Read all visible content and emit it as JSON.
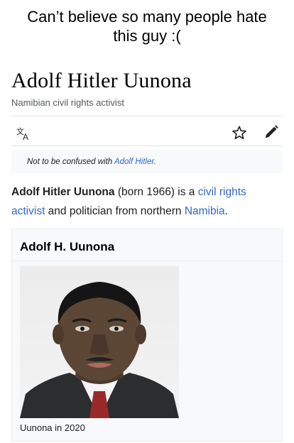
{
  "meme_caption": {
    "line1": "Can’t believe so many people hate",
    "line2": "this guy :("
  },
  "article": {
    "title": "Adolf Hitler Uunona",
    "description": "Namibian civil rights activist"
  },
  "toolbar": {
    "icons": [
      "translate-icon",
      "star-icon",
      "pencil-icon"
    ]
  },
  "hatnote": {
    "prefix": "Not to be confused with ",
    "link": "Adolf Hitler",
    "suffix": "."
  },
  "lead": {
    "bold_name": "Adolf Hitler Uunona",
    "text1": " (born 1966) is a ",
    "link1": "civil rights",
    "link1b": "activist",
    "text2": " and politician from northern ",
    "link2": "Namibia",
    "text3": "."
  },
  "infobox": {
    "title": "Adolf H. Uunona",
    "image_caption": "Uunona in 2020"
  },
  "colors": {
    "link": "#3366cc",
    "text": "#202122",
    "muted": "#54595d",
    "hatnote_bg": "#f8f9fa"
  }
}
